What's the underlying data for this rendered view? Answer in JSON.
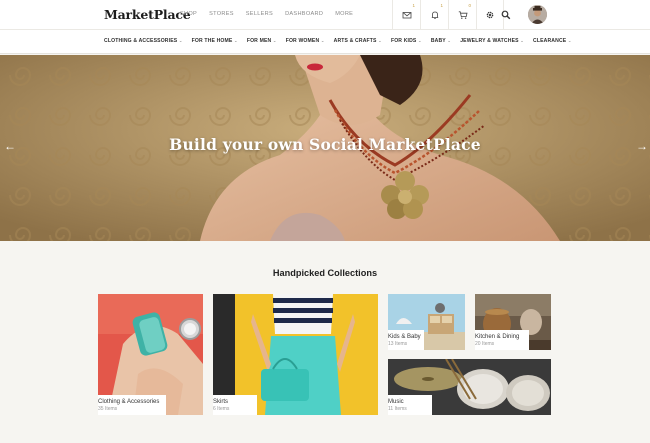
{
  "header": {
    "logo": "MarketPlace",
    "nav": [
      "SHOP",
      "STORES",
      "SELLERS",
      "DASHBOARD",
      "MORE"
    ],
    "messages_badge": "1",
    "notifications_badge": "1",
    "cart_badge": "0"
  },
  "categories": [
    "CLOTHING & ACCESSORIES",
    "FOR THE HOME",
    "FOR MEN",
    "FOR WOMEN",
    "ARTS & CRAFTS",
    "FOR KIDS",
    "BABY",
    "JEWELRY & WATCHES",
    "CLEARANCE"
  ],
  "hero": {
    "title": "Build your own Social MarketPlace",
    "prev_arrow": "←",
    "next_arrow": "→"
  },
  "collections": {
    "title": "Handpicked Collections",
    "items": [
      {
        "name": "Clothing & Accessories",
        "count": "35 Items"
      },
      {
        "name": "Skirts",
        "count": "6 Items"
      },
      {
        "name": "Kids & Baby",
        "count": "13 Items"
      },
      {
        "name": "Kitchen & Dining",
        "count": "20 Items"
      },
      {
        "name": "Music",
        "count": "11 Items"
      }
    ]
  },
  "colors": {
    "accent_gold": "#c8a24a",
    "hero_tone": "#b79a6a",
    "page_bg": "#f6f5f1"
  }
}
